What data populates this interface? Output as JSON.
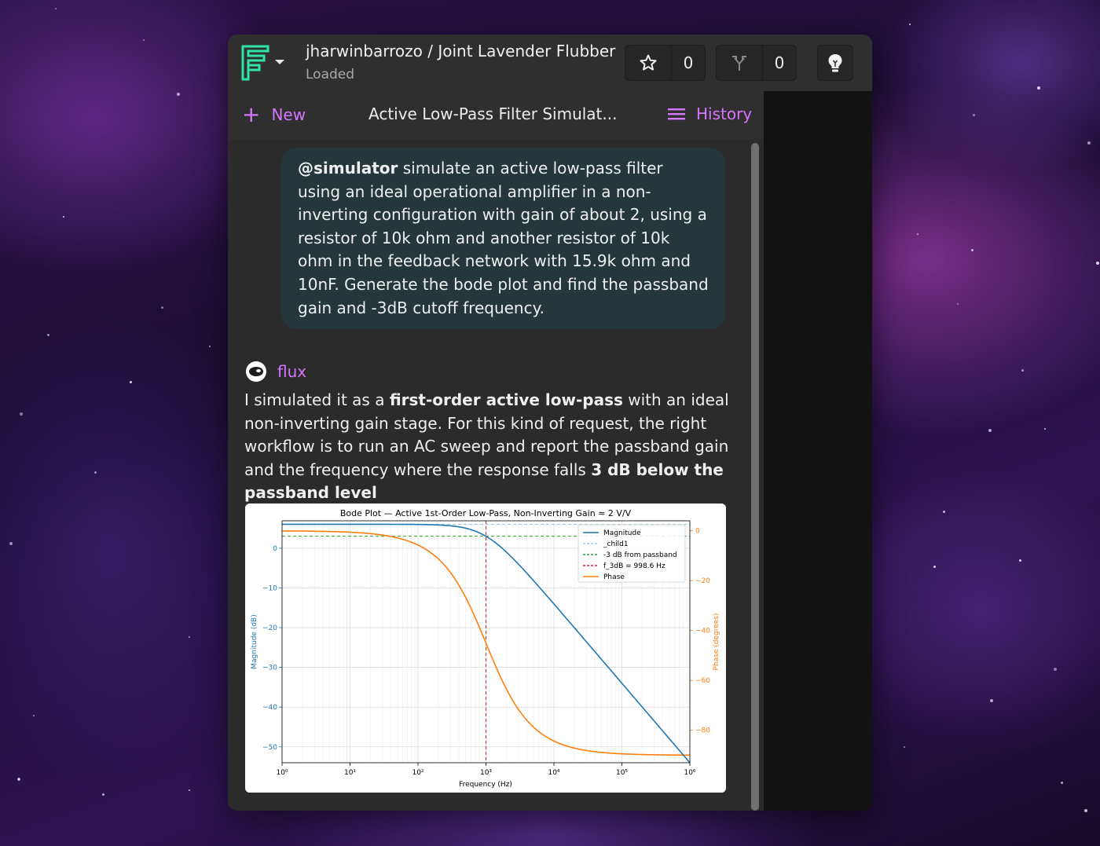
{
  "header": {
    "owner": "jharwinbarrozo",
    "separator": "/",
    "project": "Joint Lavender Flubber",
    "status": "Loaded",
    "star_count": "0",
    "fork_count": "0"
  },
  "chat": {
    "new_label": "New",
    "title": "Active Low-Pass Filter Simulat...",
    "history_label": "History"
  },
  "messages": {
    "user": {
      "mention": "@simulator",
      "text": " simulate an active low-pass filter using an ideal operational amplifier in a non-inverting configuration with gain of about 2, using a resistor of 10k ohm and another resistor of 10k ohm in the feedback network with 15.9k ohm and 10nF. Generate the bode plot and find the passband gain and -3dB cutoff frequency."
    },
    "assistant": {
      "name": "flux",
      "text_1": "I simulated it as a ",
      "bold_1": "first-order active low-pass",
      "text_2": " with an ideal non-inverting gain stage. For this kind of request, the right workflow is to run an AC sweep and report the passband gain and the frequency where the response falls ",
      "bold_2": "3 dB below the passband level"
    }
  },
  "colors": {
    "accent": "#d675ff",
    "magnitude": "#1f77b4",
    "phase": "#ff7f0e",
    "passband_ref": "#9ecae1",
    "minus3db": "#2ca02c",
    "cutoff": "#d62728"
  },
  "chart_data": {
    "type": "line",
    "title": "Bode Plot — Active 1st-Order Low-Pass, Non-Inverting Gain ≈ 2 V/V",
    "xlabel": "Frequency (Hz)",
    "ylabel": "Magnitude (dB)",
    "y2label": "Phase (degrees)",
    "xscale": "log",
    "xlim": [
      1,
      1000000
    ],
    "ylim": [
      -54,
      6.9
    ],
    "y2lim": [
      -93,
      4
    ],
    "x_ticks": [
      "10⁰",
      "10¹",
      "10²",
      "10³",
      "10⁴",
      "10⁵",
      "10⁶"
    ],
    "y_ticks": [
      0,
      -10,
      -20,
      -30,
      -40,
      -50
    ],
    "y2_ticks": [
      0,
      -20,
      -40,
      -60,
      -80
    ],
    "grid": true,
    "legend_position": "top-right",
    "passband_gain_db": 6.02,
    "cutoff_hz": 998.6,
    "series": [
      {
        "name": "Magnitude",
        "axis": "left",
        "x": [
          1,
          10,
          100,
          300,
          998.6,
          3000,
          10000,
          100000,
          1000000
        ],
        "y": [
          6.02,
          6.02,
          5.98,
          5.64,
          3.01,
          -3.72,
          -14.02,
          -34.0,
          -53.98
        ]
      },
      {
        "name": "_child1",
        "axis": "left",
        "x": [
          1,
          1000000
        ],
        "y": [
          6.02,
          6.02
        ]
      },
      {
        "name": "-3 dB from passband",
        "axis": "left",
        "x": [
          1,
          1000000
        ],
        "y": [
          3.01,
          3.01
        ]
      },
      {
        "name": "f_3dB = 998.6 Hz",
        "axis": "left",
        "x": [
          998.6,
          998.6
        ],
        "y": [
          -54,
          6.9
        ]
      },
      {
        "name": "Phase",
        "axis": "right",
        "x": [
          1,
          10,
          100,
          300,
          998.6,
          3000,
          10000,
          100000,
          1000000
        ],
        "y": [
          -0.06,
          -0.57,
          -5.71,
          -16.7,
          -45.0,
          -71.6,
          -84.3,
          -89.4,
          -89.9
        ]
      }
    ]
  }
}
